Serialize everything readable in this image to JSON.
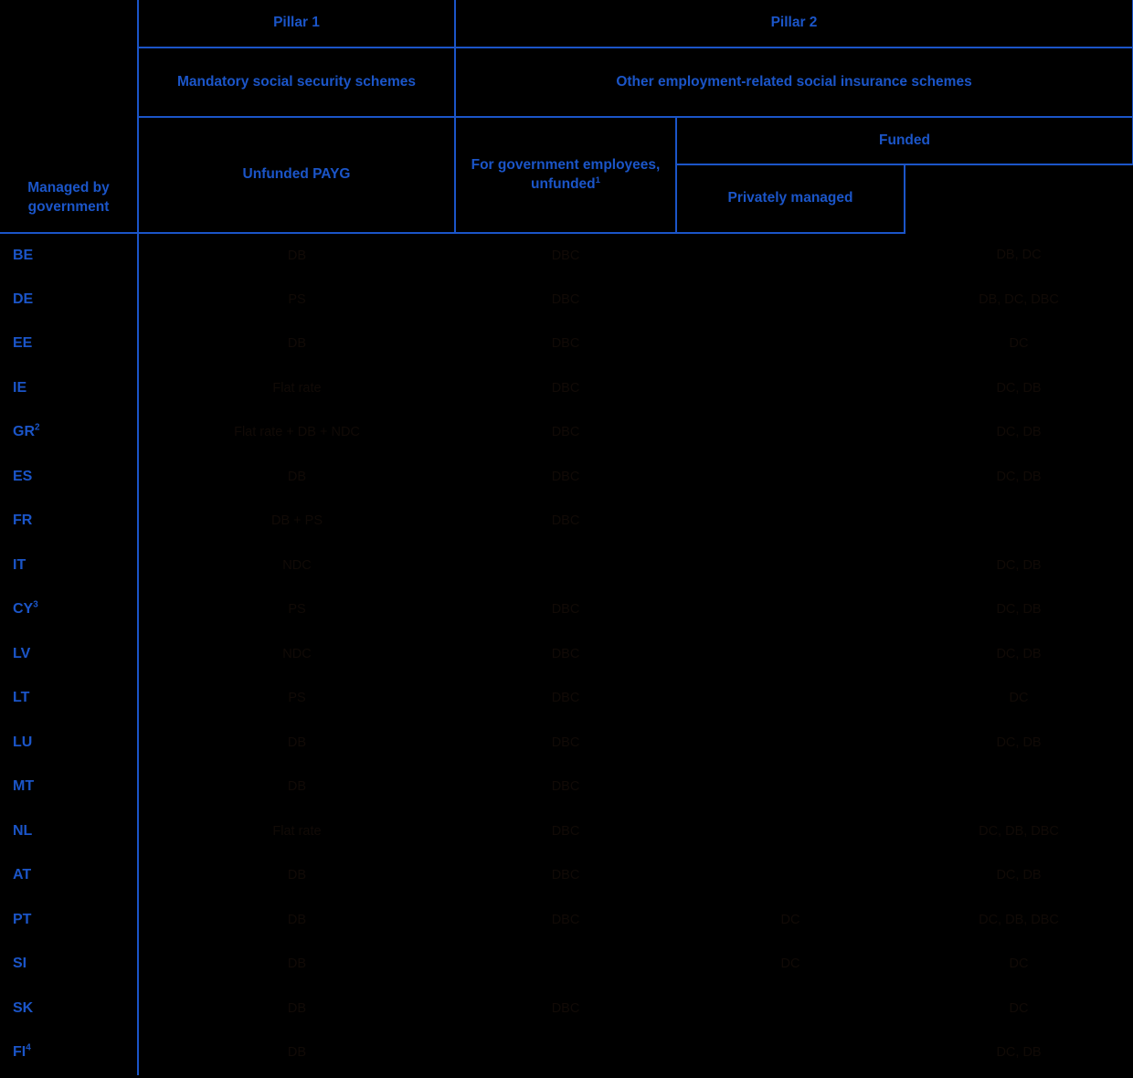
{
  "table": {
    "header": {
      "pillar1": "Pillar 1",
      "pillar2": "Pillar 2",
      "mandatory": "Mandatory social security schemes",
      "other": "Other employment-related social insurance schemes",
      "unfunded_payg": "Unfunded PAYG",
      "gov_employees": "For government employees, unfunded",
      "gov_employees_sup": "1",
      "funded": "Funded",
      "managed_by_government": "Managed by government",
      "privately_managed": "Privately managed"
    },
    "rows": [
      {
        "country": "BE",
        "sup": "",
        "payg": "DB",
        "gov": "DBC",
        "managed": "",
        "private": "DB, DC"
      },
      {
        "country": "DE",
        "sup": "",
        "payg": "PS",
        "gov": "DBC",
        "managed": "",
        "private": "DB, DC, DBC"
      },
      {
        "country": "EE",
        "sup": "",
        "payg": "DB",
        "gov": "DBC",
        "managed": "",
        "private": "DC"
      },
      {
        "country": "IE",
        "sup": "",
        "payg": "Flat rate",
        "gov": "DBC",
        "managed": "",
        "private": "DC, DB"
      },
      {
        "country": "GR",
        "sup": "2",
        "payg": "Flat rate + DB + NDC",
        "gov": "DBC",
        "managed": "",
        "private": "DC, DB"
      },
      {
        "country": "ES",
        "sup": "",
        "payg": "DB",
        "gov": "DBC",
        "managed": "",
        "private": "DC, DB"
      },
      {
        "country": "FR",
        "sup": "",
        "payg": "DB + PS",
        "gov": "DBC",
        "managed": "",
        "private": ""
      },
      {
        "country": "IT",
        "sup": "",
        "payg": "NDC",
        "gov": "",
        "managed": "",
        "private": "DC, DB"
      },
      {
        "country": "CY",
        "sup": "3",
        "payg": "PS",
        "gov": "DBC",
        "managed": "",
        "private": "DC, DB"
      },
      {
        "country": "LV",
        "sup": "",
        "payg": "NDC",
        "gov": "DBC",
        "managed": "",
        "private": "DC, DB"
      },
      {
        "country": "LT",
        "sup": "",
        "payg": "PS",
        "gov": "DBC",
        "managed": "",
        "private": "DC"
      },
      {
        "country": "LU",
        "sup": "",
        "payg": "DB",
        "gov": "DBC",
        "managed": "",
        "private": "DC, DB"
      },
      {
        "country": "MT",
        "sup": "",
        "payg": "DB",
        "gov": "DBC",
        "managed": "",
        "private": ""
      },
      {
        "country": "NL",
        "sup": "",
        "payg": "Flat rate",
        "gov": "DBC",
        "managed": "",
        "private": "DC, DB, DBC"
      },
      {
        "country": "AT",
        "sup": "",
        "payg": "DB",
        "gov": "DBC",
        "managed": "",
        "private": "DC, DB"
      },
      {
        "country": "PT",
        "sup": "",
        "payg": "DB",
        "gov": "DBC",
        "managed": "DC",
        "private": "DC, DB, DBC"
      },
      {
        "country": "SI",
        "sup": "",
        "payg": "DB",
        "gov": "",
        "managed": "DC",
        "private": "DC"
      },
      {
        "country": "SK",
        "sup": "",
        "payg": "DB",
        "gov": "DBC",
        "managed": "",
        "private": "DC"
      },
      {
        "country": "FI",
        "sup": "4",
        "payg": "DB",
        "gov": "",
        "managed": "",
        "private": "DC, DB"
      }
    ]
  },
  "colors": {
    "accent": "#1b55c8",
    "background": "#000000",
    "body_text": "#110a06"
  }
}
